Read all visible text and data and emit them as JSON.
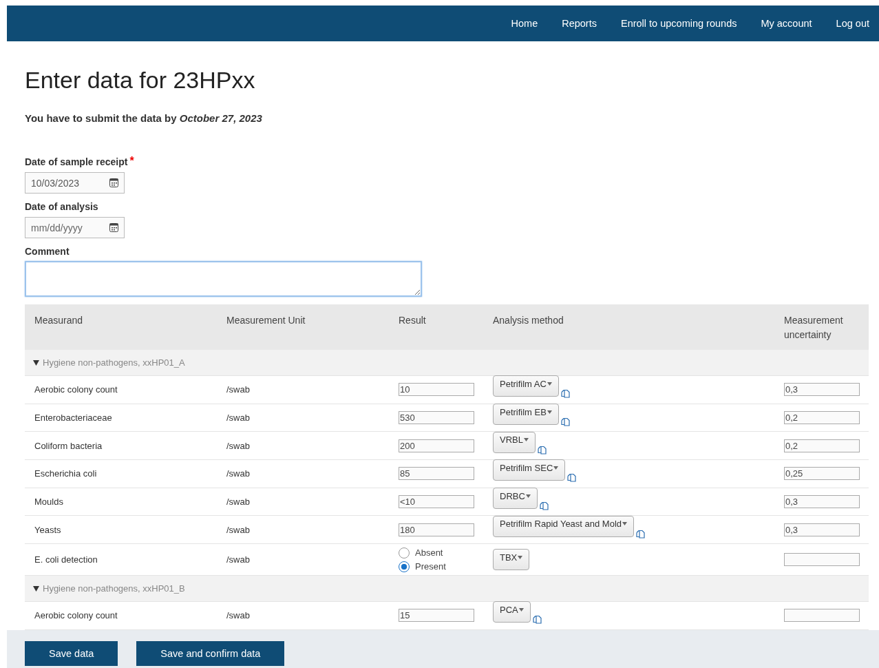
{
  "nav": [
    "Home",
    "Reports",
    "Enroll to upcoming rounds",
    "My account",
    "Log out"
  ],
  "title": "Enter data for 23HPxx",
  "deadline": "You have to submit the data by *October 27, 2023*",
  "fields": [
    {
      "kind": "date",
      "label": "Date of sample receipt",
      "required_mark": "*",
      "value": "10/03/2023"
    },
    {
      "kind": "date",
      "label": "Date of analysis",
      "placeholder": "mm/dd/yyyy"
    },
    {
      "kind": "textarea",
      "label": "Comment",
      "focused": true
    }
  ],
  "table": {
    "columns": [
      "Measurand",
      "Measurement Unit",
      "Result",
      "Analysis method",
      "Measurement uncertainty"
    ],
    "groups": [
      {
        "title": "Hygiene non-pathogens, xxHP01_A",
        "expanded": true,
        "rows": [
          {
            "kind": "value",
            "measurand": "Aerobic colony count",
            "unit": "/swab",
            "result": "10",
            "method": "Petrifilm AC",
            "uncertainty": "0,3"
          },
          {
            "kind": "value",
            "measurand": "Enterobacteriaceae",
            "unit": "/swab",
            "result": "530",
            "method": "Petrifilm EB",
            "uncertainty": "0,2"
          },
          {
            "kind": "value",
            "measurand": "Coliform bacteria",
            "unit": "/swab",
            "result": "200",
            "method": "VRBL",
            "uncertainty": "0,2"
          },
          {
            "kind": "value",
            "measurand": "Escherichia coli",
            "unit": "/swab",
            "result": "85",
            "method": "Petrifilm SEC",
            "uncertainty": "0,25"
          },
          {
            "kind": "value",
            "measurand": "Moulds",
            "unit": "/swab",
            "result": "<10",
            "method": "DRBC",
            "uncertainty": "0,3"
          },
          {
            "kind": "value",
            "measurand": "Yeasts",
            "unit": "/swab",
            "result": "180",
            "method": "Petrifilm Rapid Yeast and Mold",
            "uncertainty": "0,3"
          },
          {
            "kind": "choice",
            "measurand": "E. coli detection",
            "unit": "/swab",
            "options": [
              {
                "label": "Absent",
                "selected": false
              },
              {
                "label": "Present",
                "selected": true
              }
            ],
            "method": "TBX"
          }
        ]
      },
      {
        "title": "Hygiene non-pathogens, xxHP01_B",
        "expanded": true,
        "rows": [
          {
            "kind": "value",
            "measurand": "Aerobic colony count",
            "unit": "/swab",
            "result": "15",
            "method": "PCA"
          }
        ]
      }
    ]
  },
  "buttons": [
    "Save data",
    "Save and confirm data"
  ]
}
